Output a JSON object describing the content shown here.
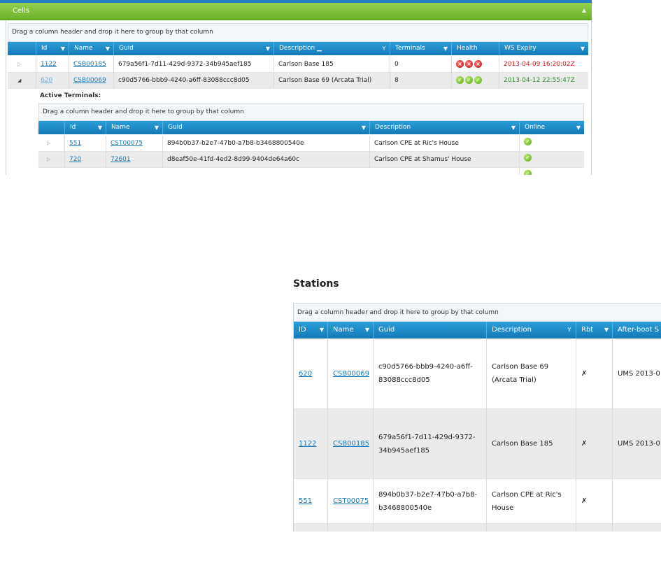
{
  "cells": {
    "title": "Cells",
    "collapse_icon": "▲",
    "group_hint": "Drag a column header and drop it here to group by that column",
    "columns": [
      "Id",
      "Name",
      "Guid",
      "Description",
      "Terminals",
      "Health",
      "WS Expiry"
    ],
    "rows": [
      {
        "id": "1122",
        "name": "CSB00185",
        "guid": "679a56f1-7d11-429d-9372-34b945aef185",
        "description": "Carlson Base 185",
        "terminals": "0",
        "health": "error",
        "ws_expiry": "2013-04-09 16:20:02Z",
        "expanded": false
      },
      {
        "id": "620",
        "name": "CSB00069",
        "guid": "c90d5766-bbb9-4240-a6ff-83088ccc8d05",
        "description": "Carlson Base 69 (Arcata Trial)",
        "terminals": "8",
        "health": "ok",
        "ws_expiry": "2013-04-12 22:55:47Z",
        "expanded": true
      }
    ],
    "active_terminals_label": "Active Terminals:",
    "terminals": {
      "group_hint": "Drag a column header and drop it here to group by that column",
      "columns": [
        "Id",
        "Name",
        "Guid",
        "Description",
        "Online"
      ],
      "rows": [
        {
          "id": "551",
          "name": "CST00075",
          "guid": "894b0b37-b2e7-47b0-a7b8-b3468800540e",
          "description": "Carlson CPE at Ric's House",
          "online": "ok"
        },
        {
          "id": "720",
          "name": "72601",
          "guid": "d8eaf50e-41fd-4ed2-8d99-9404de64a60c",
          "description": "Carlson CPE at Shamus' House",
          "online": "ok"
        }
      ]
    },
    "colors": {
      "header_green": "#7dc043",
      "grid_header_blue": "#1f8ccc",
      "expired_red": "#d31a1a",
      "valid_green": "#2e8b2e"
    }
  },
  "stations": {
    "title": "Stations",
    "group_hint": "Drag a column header and drop it here to group by that column",
    "columns": [
      "ID",
      "Name",
      "Guid",
      "Description",
      "Rbt",
      "After-boot S"
    ],
    "rows": [
      {
        "id": "620",
        "name": "CSB00069",
        "guid_line1": "c90d5766-bbb9-4240-a6ff-",
        "guid_line2": "83088ccc8d05",
        "desc_line1": "Carlson Base 69",
        "desc_line2": "(Arcata Trial)",
        "rbt": "✗",
        "after_boot": "UMS 2013-0"
      },
      {
        "id": "1122",
        "name": "CSB00185",
        "guid_line1": "679a56f1-7d11-429d-9372-",
        "guid_line2": "34b945aef185",
        "desc_line1": "Carlson Base 185",
        "desc_line2": "",
        "rbt": "✗",
        "after_boot": "UMS 2013-0"
      },
      {
        "id": "551",
        "name": "CST00075",
        "guid_line1": "894b0b37-b2e7-47b0-a7b8-",
        "guid_line2": "b3468800540e",
        "desc_line1": "Carlson CPE at Ric's",
        "desc_line2": "House",
        "rbt": "✗",
        "after_boot": ""
      }
    ]
  }
}
